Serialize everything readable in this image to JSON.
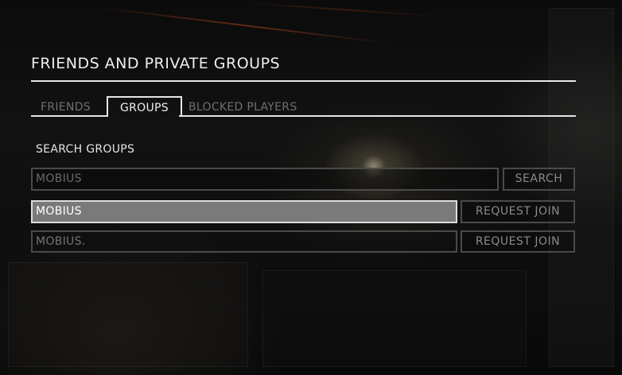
{
  "page": {
    "title": "FRIENDS AND PRIVATE GROUPS"
  },
  "tabs": [
    {
      "label": "FRIENDS",
      "active": false
    },
    {
      "label": "GROUPS",
      "active": true
    },
    {
      "label": "BLOCKED PLAYERS",
      "active": false
    }
  ],
  "search": {
    "label": "SEARCH GROUPS",
    "value": "MOBIUS",
    "button_label": "SEARCH"
  },
  "results": [
    {
      "name": "MOBIUS",
      "selected": true,
      "action_label": "REQUEST JOIN"
    },
    {
      "name": "MOBIUS.",
      "selected": false,
      "action_label": "REQUEST JOIN"
    }
  ],
  "colors": {
    "background": "#0e0e0e",
    "text_primary": "#ededed",
    "text_muted": "#6f6f6f",
    "border": "#4a4a4a",
    "selected_row": "#7a7a7a"
  }
}
